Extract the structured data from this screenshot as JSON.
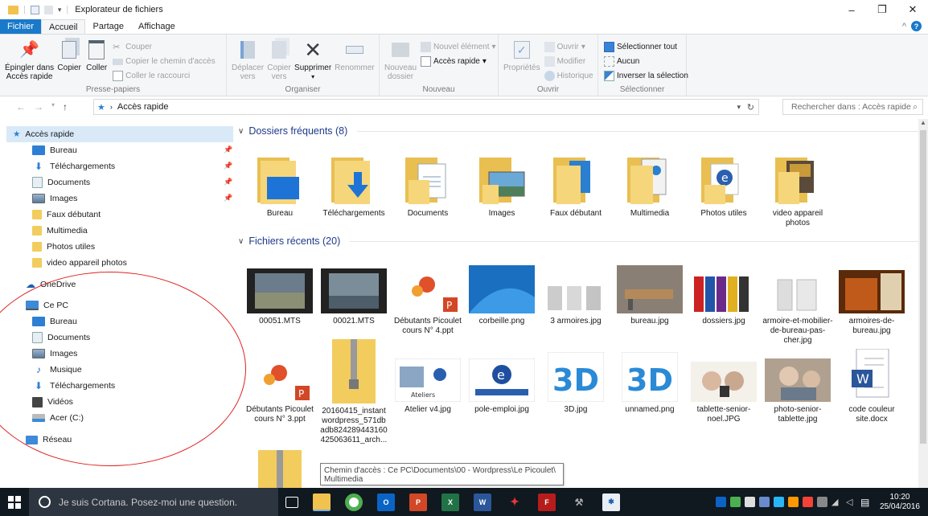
{
  "window": {
    "title": "Explorateur de fichiers"
  },
  "ribbon_tabs": [
    "Fichier",
    "Accueil",
    "Partage",
    "Affichage"
  ],
  "ribbon": {
    "presse_papiers": {
      "label": "Presse-papiers",
      "pin": "Épingler dans\nAccès rapide",
      "copy": "Copier",
      "paste": "Coller",
      "cut": "Couper",
      "copy_path": "Copier le chemin d'accès",
      "paste_shortcut": "Coller le raccourci"
    },
    "organiser": {
      "label": "Organiser",
      "move": "Déplacer\nvers",
      "copyto": "Copier\nvers",
      "delete": "Supprimer",
      "rename": "Renommer"
    },
    "nouveau": {
      "label": "Nouveau",
      "new_folder": "Nouveau\ndossier",
      "new_item": "Nouvel élément",
      "quick_access": "Accès rapide"
    },
    "ouvrir": {
      "label": "Ouvrir",
      "properties": "Propriétés",
      "open": "Ouvrir",
      "edit": "Modifier",
      "history": "Historique"
    },
    "selectionner": {
      "label": "Sélectionner",
      "select_all": "Sélectionner tout",
      "none": "Aucun",
      "invert": "Inverser la sélection"
    }
  },
  "address": {
    "path": "Accès rapide",
    "search_placeholder": "Rechercher dans : Accès rapide"
  },
  "nav": {
    "quick_access": "Accès rapide",
    "items": [
      "Bureau",
      "Téléchargements",
      "Documents",
      "Images",
      "Faux débutant",
      "Multimedia",
      "Photos utiles",
      "video appareil photos"
    ],
    "onedrive": "OneDrive",
    "pc": "Ce PC",
    "pc_items": [
      "Bureau",
      "Documents",
      "Images",
      "Musique",
      "Téléchargements",
      "Vidéos",
      "Acer (C:)"
    ],
    "network": "Réseau"
  },
  "frequent": {
    "header": "Dossiers fréquents (8)",
    "items": [
      "Bureau",
      "Téléchargements",
      "Documents",
      "Images",
      "Faux débutant",
      "Multimedia",
      "Photos utiles",
      "video appareil photos"
    ]
  },
  "recent": {
    "header": "Fichiers récents (20)",
    "row1": [
      "00051.MTS",
      "00021.MTS",
      "Débutants Picoulet cours N° 4.ppt",
      "corbeille.png",
      "3 armoires.jpg",
      "bureau.jpg",
      "dossiers.jpg",
      "armoire-et-mobilier-de-bureau-pas-cher.jpg",
      "armoires-de-bureau.jpg"
    ],
    "row2": [
      "Débutants Picoulet cours N° 3.ppt",
      "20160415_instant wordpress_571db adb824289443160 425063611_arch...",
      "Atelier v4.jpg",
      "pole-emploi.jpg",
      "3D.jpg",
      "unnamed.png",
      "tablette-senior-noel.JPG",
      "photo-senior-tablette.jpg",
      "code couleur site.docx"
    ]
  },
  "tooltip": "Chemin d'accès : Ce PC\\Documents\\00 - Wordpress\\Le Picoulet\\ Multimedia",
  "taskbar": {
    "cortana": "Je suis Cortana. Posez-moi une question.",
    "time": "10:20",
    "date": "25/04/2016"
  }
}
